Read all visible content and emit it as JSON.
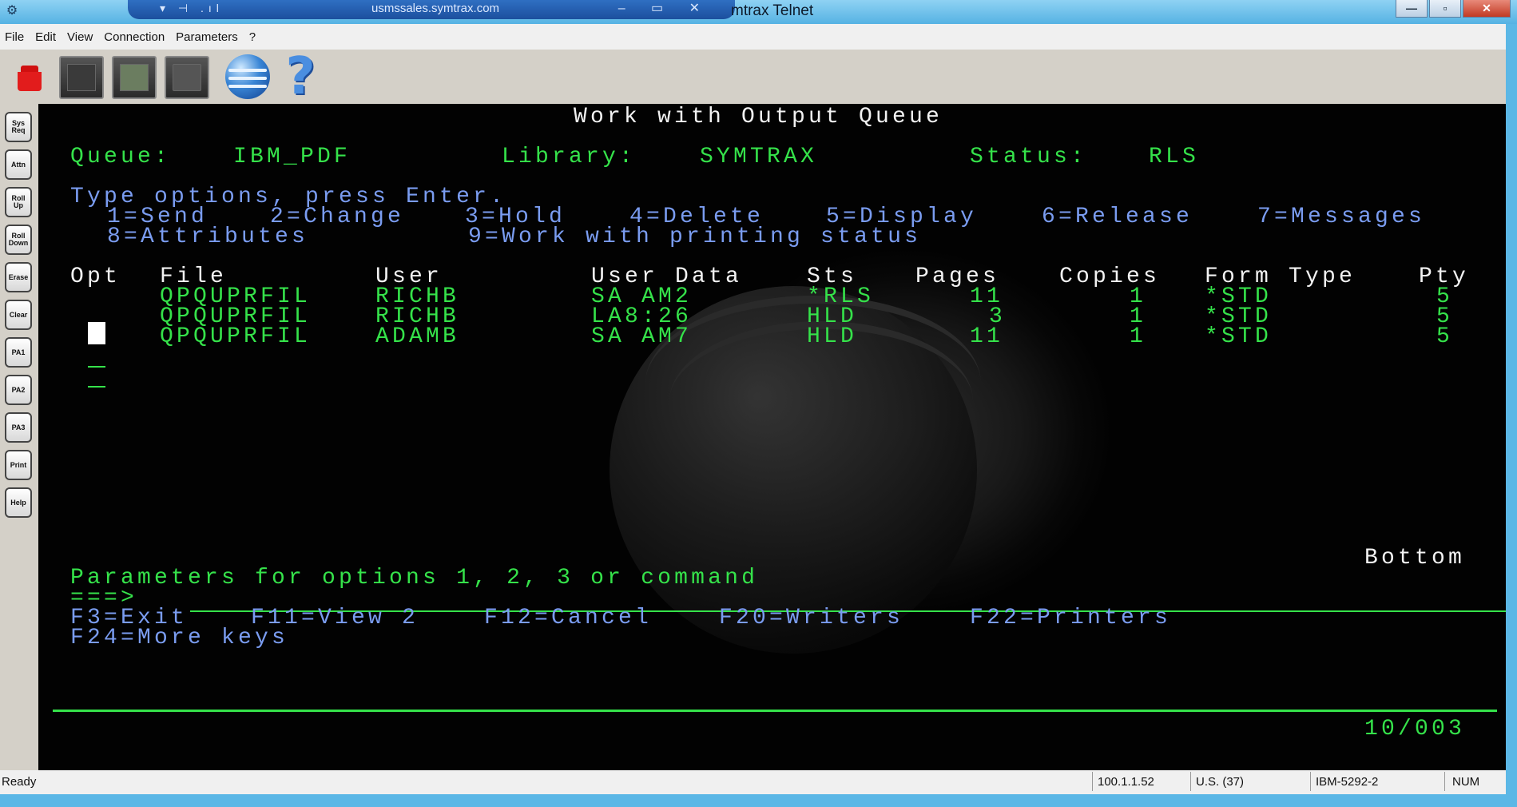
{
  "rdp_bar": {
    "host": "usmssales.symtrax.com",
    "left_icons": "▾ ⊣ .ıl",
    "controls": "–  ▭  ✕"
  },
  "window": {
    "title": "mtrax Telnet",
    "min": "—",
    "max": "▫",
    "close": "✕"
  },
  "menu": [
    "File",
    "Edit",
    "View",
    "Connection",
    "Parameters",
    "?"
  ],
  "toolbar": {
    "help_glyph": "?"
  },
  "keys": [
    "Sys Req",
    "Attn",
    "Roll Up",
    "Roll Down",
    "Erase",
    "Clear",
    "PA1",
    "PA2",
    "PA3",
    "Print",
    "Help"
  ],
  "screen": {
    "title": "Work with Output Queue",
    "queue_label": "Queue:",
    "queue_value": "IBM_PDF",
    "library_label": "Library:",
    "library_value": "SYMTRAX",
    "status_label": "Status:",
    "status_value": "RLS",
    "instructions": "Type options, press Enter.",
    "options_line1": [
      "1=Send",
      "2=Change",
      "3=Hold",
      "4=Delete",
      "5=Display",
      "6=Release",
      "7=Messages"
    ],
    "options_line2": [
      "8=Attributes",
      "9=Work with printing status"
    ],
    "columns": [
      "Opt",
      "File",
      "User",
      "User Data",
      "Sts",
      "Pages",
      "Copies",
      "Form Type",
      "Pty"
    ],
    "rows": [
      {
        "file": "QPQUPRFIL",
        "user": "RICHB",
        "user_data": "SA AM2",
        "sts": "*RLS",
        "pages": "11",
        "copies": "1",
        "form_type": "*STD",
        "pty": "5"
      },
      {
        "file": "QPQUPRFIL",
        "user": "RICHB",
        "user_data": "LA8:26",
        "sts": "HLD",
        "pages": "3",
        "copies": "1",
        "form_type": "*STD",
        "pty": "5"
      },
      {
        "file": "QPQUPRFIL",
        "user": "ADAMB",
        "user_data": "SA AM7",
        "sts": "HLD",
        "pages": "11",
        "copies": "1",
        "form_type": "*STD",
        "pty": "5"
      }
    ],
    "bottom": "Bottom",
    "params_prompt": "Parameters for options 1, 2, 3 or command",
    "cmd_prompt": "===>",
    "fkeys_line1": [
      "F3=Exit",
      "F11=View 2",
      "F12=Cancel",
      "F20=Writers",
      "F22=Printers"
    ],
    "fkeys_line2": [
      "F24=More keys"
    ],
    "cursor_pos": "10/003"
  },
  "status": {
    "ready": "Ready",
    "ip": "100.1.1.52",
    "locale": "U.S. (37)",
    "terminal": "IBM-5292-2",
    "num": "NUM"
  }
}
